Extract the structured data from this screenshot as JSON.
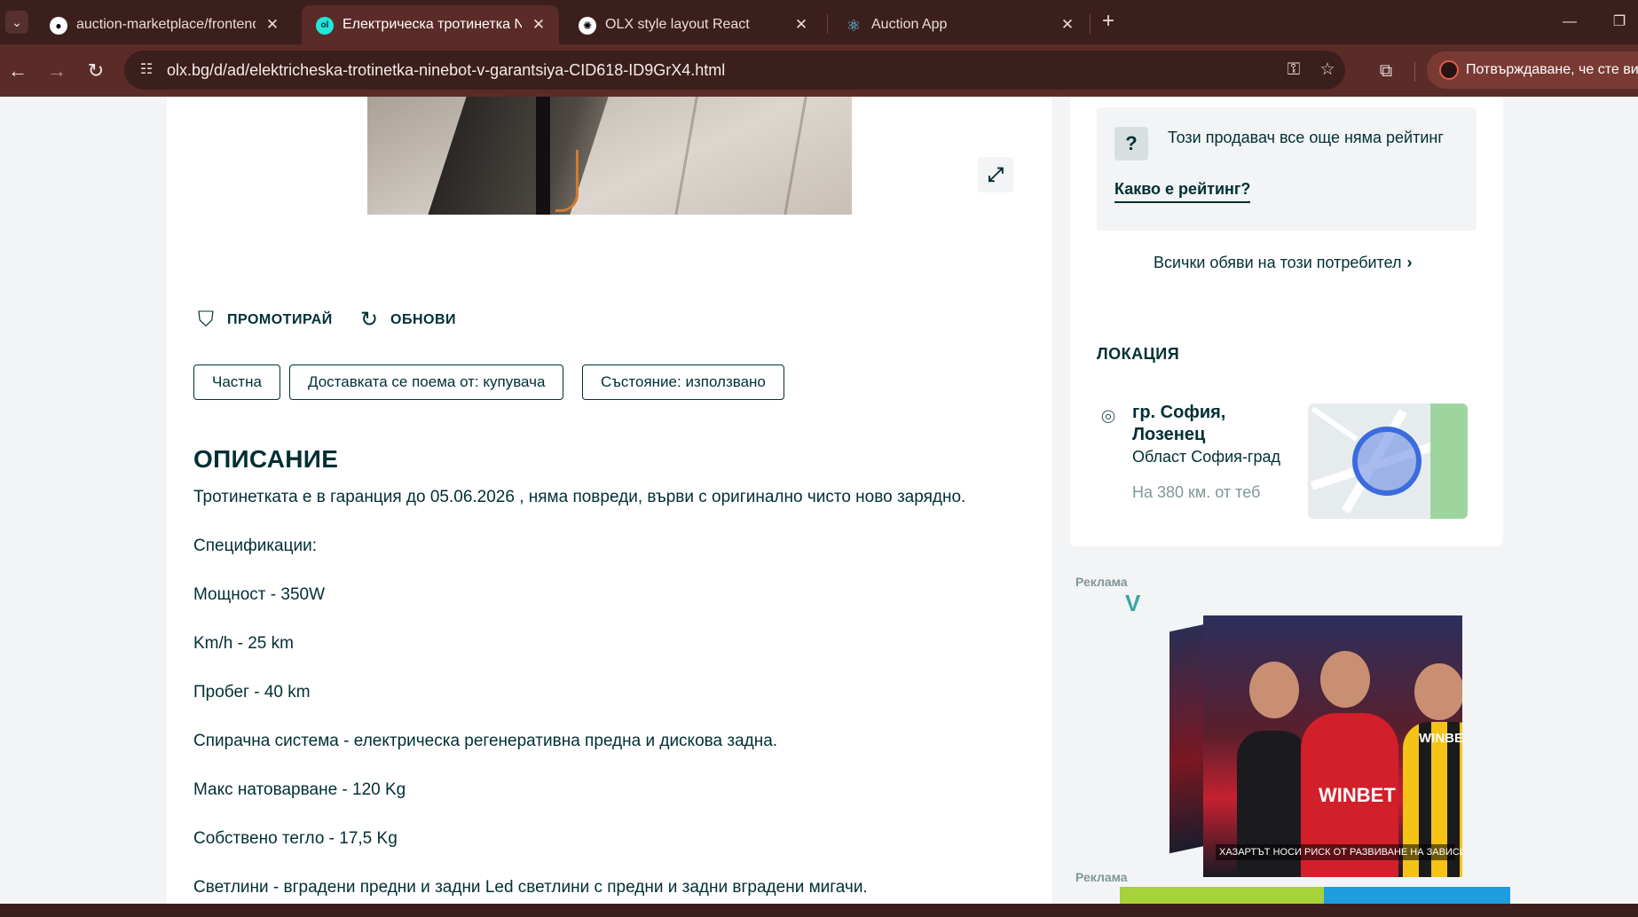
{
  "browser": {
    "tabs": [
      {
        "title": "auction-marketplace/frontend/",
        "favicon": "github-icon",
        "active": false
      },
      {
        "title": "Електрическа тротинетка Nine",
        "favicon": "olx-icon",
        "active": true
      },
      {
        "title": "OLX style layout React",
        "favicon": "openai-icon",
        "active": false
      },
      {
        "title": "Auction App",
        "favicon": "react-icon",
        "active": false
      }
    ],
    "url": "olx.bg/d/ad/elektricheska-trotinetka-ninebot-v-garantsiya-CID618-ID9GrX4.html",
    "profile_label": "Потвърждаване, че сте вие",
    "accent": "#5b2b28"
  },
  "actions": {
    "promote": "ПРОМОТИРАЙ",
    "refresh": "ОБНОВИ"
  },
  "tags": [
    "Частна",
    "Доставката се поема от: купувача",
    "Състояние: използвано"
  ],
  "description": {
    "title": "ОПИСАНИЕ",
    "lines": [
      "Тротинетката е в гаранция до 05.06.2026 , няма повреди, върви с оригинално чисто ново зарядно.",
      "Спецификации:",
      "Мощност - 350W",
      "Km/h - 25 km",
      "Пробег - 40 km",
      "Спирачна система - електрическа регенеративна предна и дискова задна.",
      "Макс натоварване - 120 Kg",
      "Собствено тегло - 17,5 Kg",
      "Светлини - вградени предни и задни Led светлини с предни и задни вградени мигачи."
    ]
  },
  "seller": {
    "rating_text": "Този продавач все още няма рейтинг",
    "rating_link": "Какво е рейтинг?",
    "all_ads": "Всички обяви на този потребител"
  },
  "location": {
    "title": "ЛОКАЦИЯ",
    "city": "гр. София, Лозенец",
    "region": "Област София-град",
    "distance": "На 380 км. от теб"
  },
  "ads": {
    "label": "Реклама",
    "brand": "WINBET",
    "warning": "ХАЗАРТЪТ НОСИ РИСК ОТ РАЗВИВАНЕ НА ЗАВИСИМОСТ"
  },
  "colors": {
    "text": "#002f34",
    "muted": "#7f9799",
    "background": "#f2f4f5"
  }
}
